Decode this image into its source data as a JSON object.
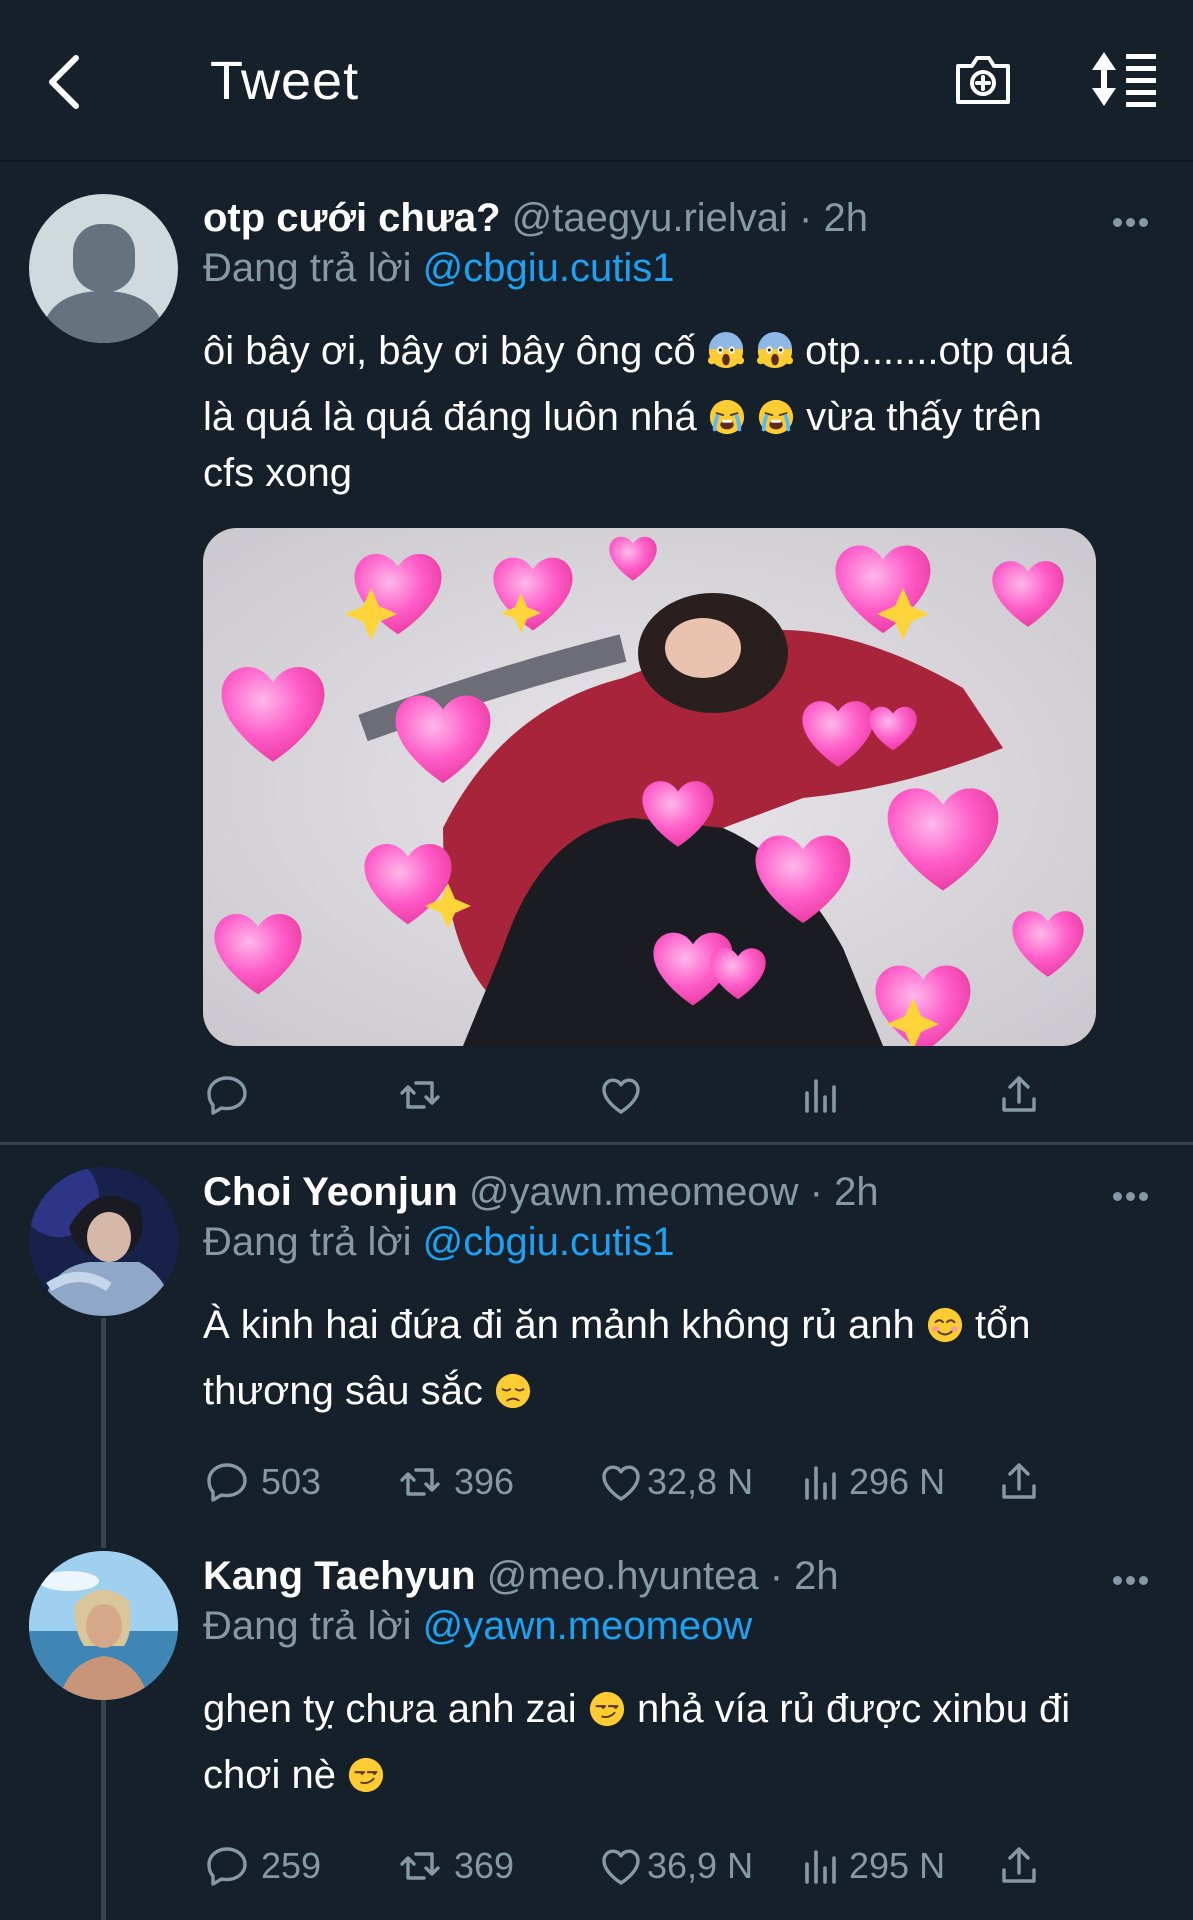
{
  "header": {
    "title": "Tweet",
    "back_icon": "chevron-left-icon",
    "camera_icon": "camera-plus-icon",
    "sort_icon": "sort-list-icon"
  },
  "colors": {
    "background": "#15202b",
    "accent": "#1da1f2",
    "muted": "#8899a6",
    "divider": "#38444d"
  },
  "tweets": [
    {
      "name": "otp cưới chưa?",
      "handle": "@taegyu.rielvai · 2h",
      "replying_prefix": "Đang trả lời ",
      "replying_to": "@cbgiu.cutis1",
      "text_1": "ôi bây ơi, bây ơi bây ông cố",
      "text_2": " otp.......otp quá",
      "text_3": "là quá là quá đáng luôn nhá",
      "text_4": " vừa thấy trên",
      "text_5": "cfs xong",
      "emojis": [
        "scream-emoji",
        "scream-emoji",
        "loudly-crying-emoji",
        "loudly-crying-emoji"
      ],
      "media": "photo-with-heart-emojis",
      "counts": {
        "reply": "",
        "retweet": "",
        "like": "",
        "views": ""
      }
    },
    {
      "name": "Choi Yeonjun",
      "handle": "@yawn.meomeow · 2h",
      "replying_prefix": "Đang trả lời ",
      "replying_to": "@cbgiu.cutis1",
      "text_1": "À kinh hai đứa đi ăn mảnh không rủ anh",
      "text_2": " tổn",
      "text_3": "thương sâu sắc",
      "emojis": [
        "smiling-emoji",
        "disappointed-emoji"
      ],
      "counts": {
        "reply": "503",
        "retweet": "396",
        "like": "32,8 N",
        "views": "296 N"
      }
    },
    {
      "name": "Kang Taehyun",
      "handle": "@meo.hyuntea · 2h",
      "replying_prefix": "Đang trả lời ",
      "replying_to": "@yawn.meomeow",
      "text_1": "ghen tỵ chưa anh zai",
      "text_2": " nhả vía rủ được xinbu đi",
      "text_3": "chơi nè",
      "emojis": [
        "smirking-emoji",
        "smirking-emoji"
      ],
      "counts": {
        "reply": "259",
        "retweet": "369",
        "like": "36,9 N",
        "views": "295 N"
      }
    }
  ]
}
